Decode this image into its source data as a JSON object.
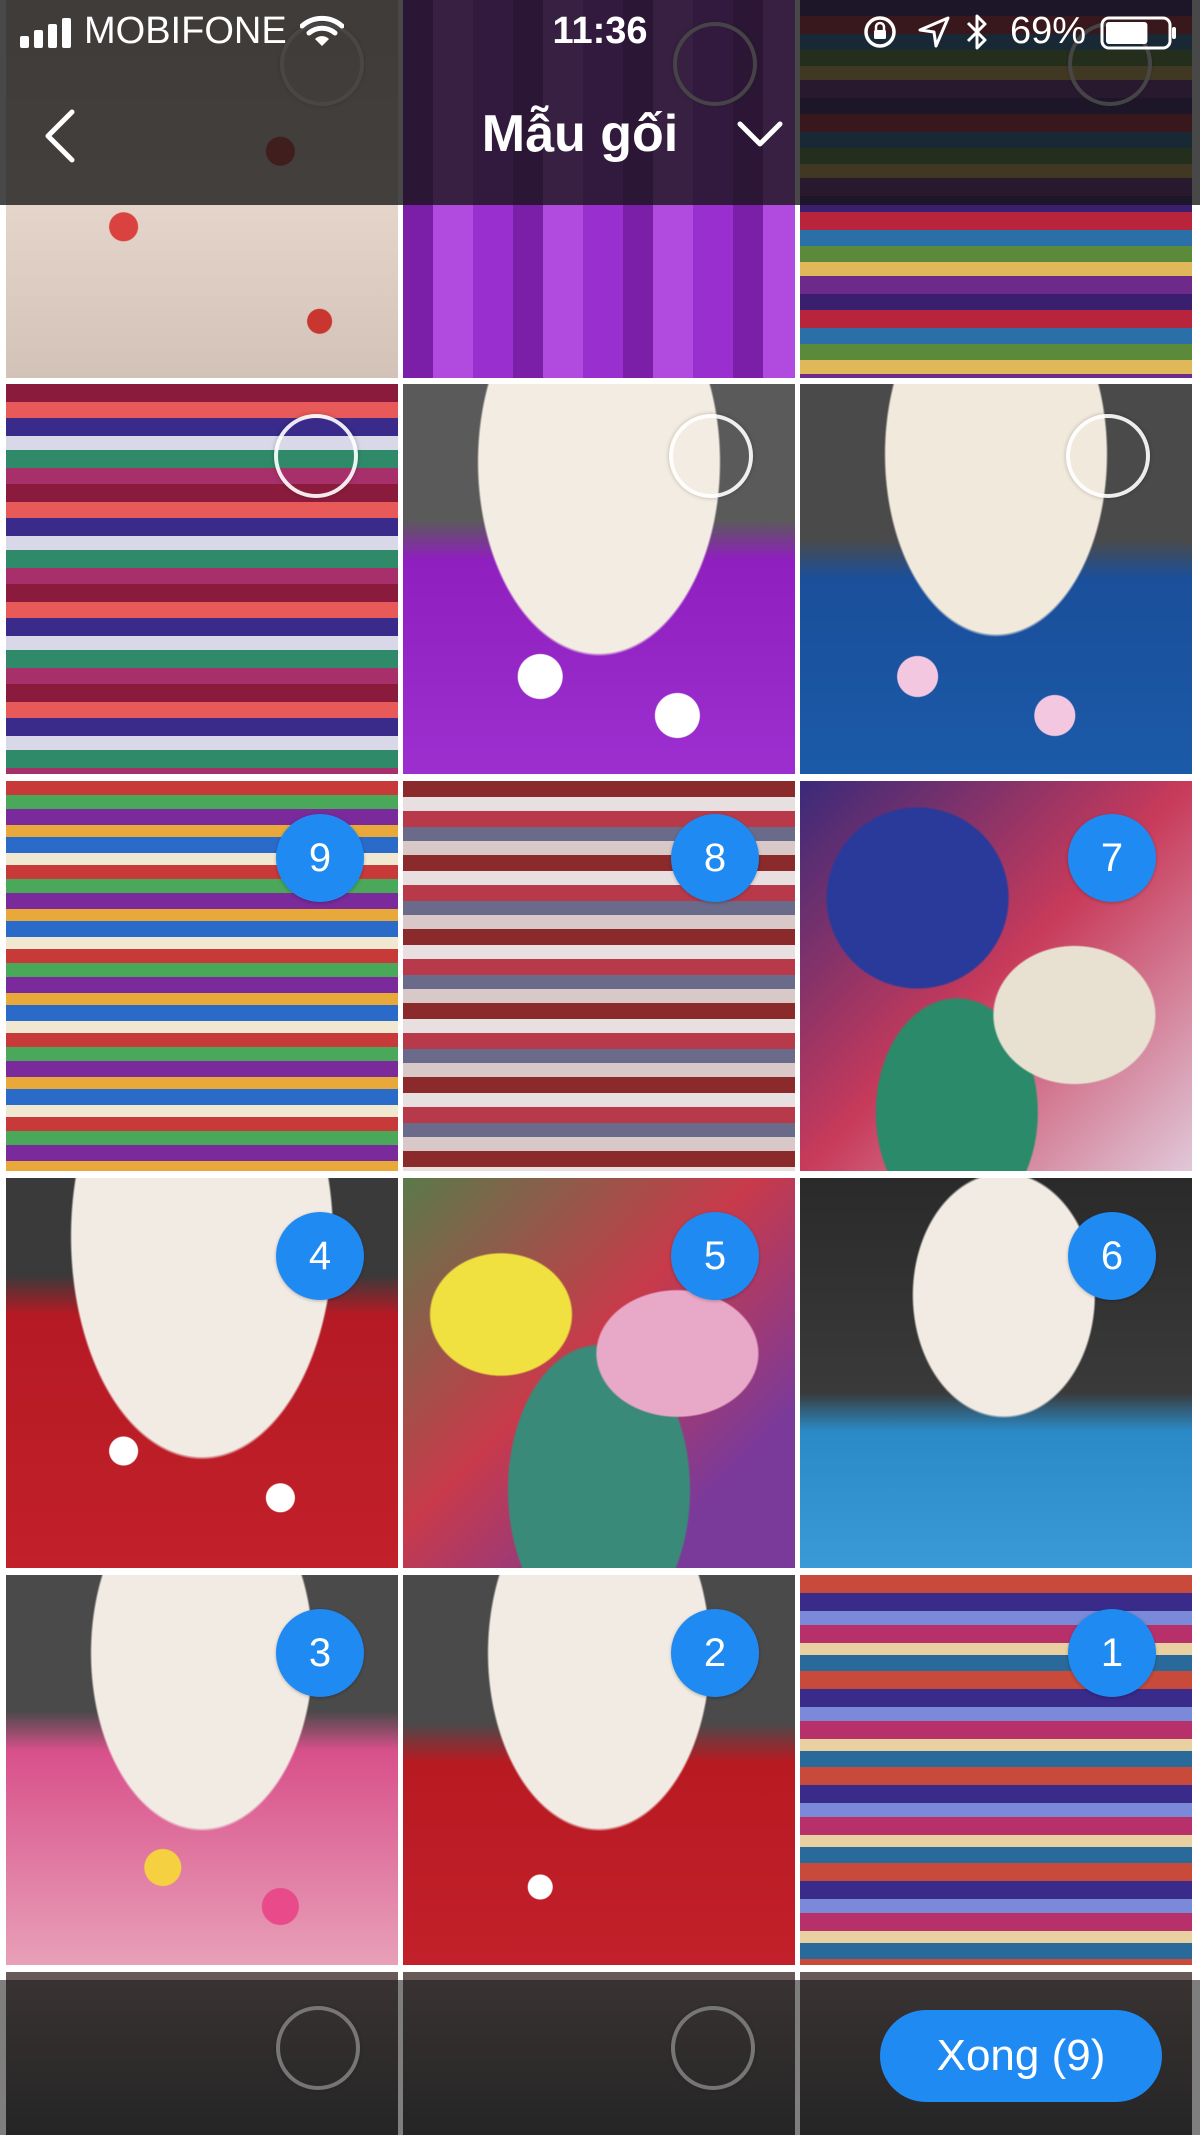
{
  "status_bar": {
    "carrier": "MOBIFONE",
    "time": "11:36",
    "battery_percent": "69%",
    "icons": [
      "signal-icon",
      "wifi-icon",
      "orientation-lock-icon",
      "location-icon",
      "bluetooth-icon",
      "battery-icon"
    ],
    "battery_level": 0.69
  },
  "nav": {
    "title": "Mẫu gối",
    "back_icon": "chevron-left-icon",
    "dropdown_icon": "chevron-down-icon"
  },
  "grid": {
    "rows": [
      {
        "cells": [
          {
            "photo": "pink-floral-bed",
            "selected": ""
          },
          {
            "photo": "purple-sheet-bed",
            "selected": ""
          },
          {
            "photo": "stacked-fabrics",
            "selected": ""
          }
        ]
      },
      {
        "cells": [
          {
            "photo": "stacked-fabrics-shelf",
            "selected": ""
          },
          {
            "photo": "purple-floral-bed",
            "selected": ""
          },
          {
            "photo": "blue-floral-bed",
            "selected": ""
          }
        ]
      },
      {
        "cells": [
          {
            "photo": "colorful-stacks",
            "selected": "9"
          },
          {
            "photo": "striped-stacks",
            "selected": "8"
          },
          {
            "photo": "blue-fabric-pile",
            "selected": "7"
          }
        ]
      },
      {
        "cells": [
          {
            "photo": "red-cartoon-bed",
            "selected": "4"
          },
          {
            "photo": "mixed-fabric-pile",
            "selected": "5"
          },
          {
            "photo": "light-blue-bed",
            "selected": "6"
          }
        ]
      },
      {
        "cells": [
          {
            "photo": "yellow-floral-bed",
            "selected": "3"
          },
          {
            "photo": "red-cartoon-bed-2",
            "selected": "2"
          },
          {
            "photo": "floral-stacks",
            "selected": "1"
          }
        ]
      },
      {
        "cells": [
          {
            "photo": "dark-fabric",
            "selected": ""
          },
          {
            "photo": "dark-fabric",
            "selected": ""
          },
          {
            "photo": "dark-fabric",
            "selected": ""
          }
        ]
      }
    ]
  },
  "footer": {
    "done_label": "Xong (9)"
  },
  "colors": {
    "accent": "#1f8bf2",
    "bar_background": "#141414"
  }
}
